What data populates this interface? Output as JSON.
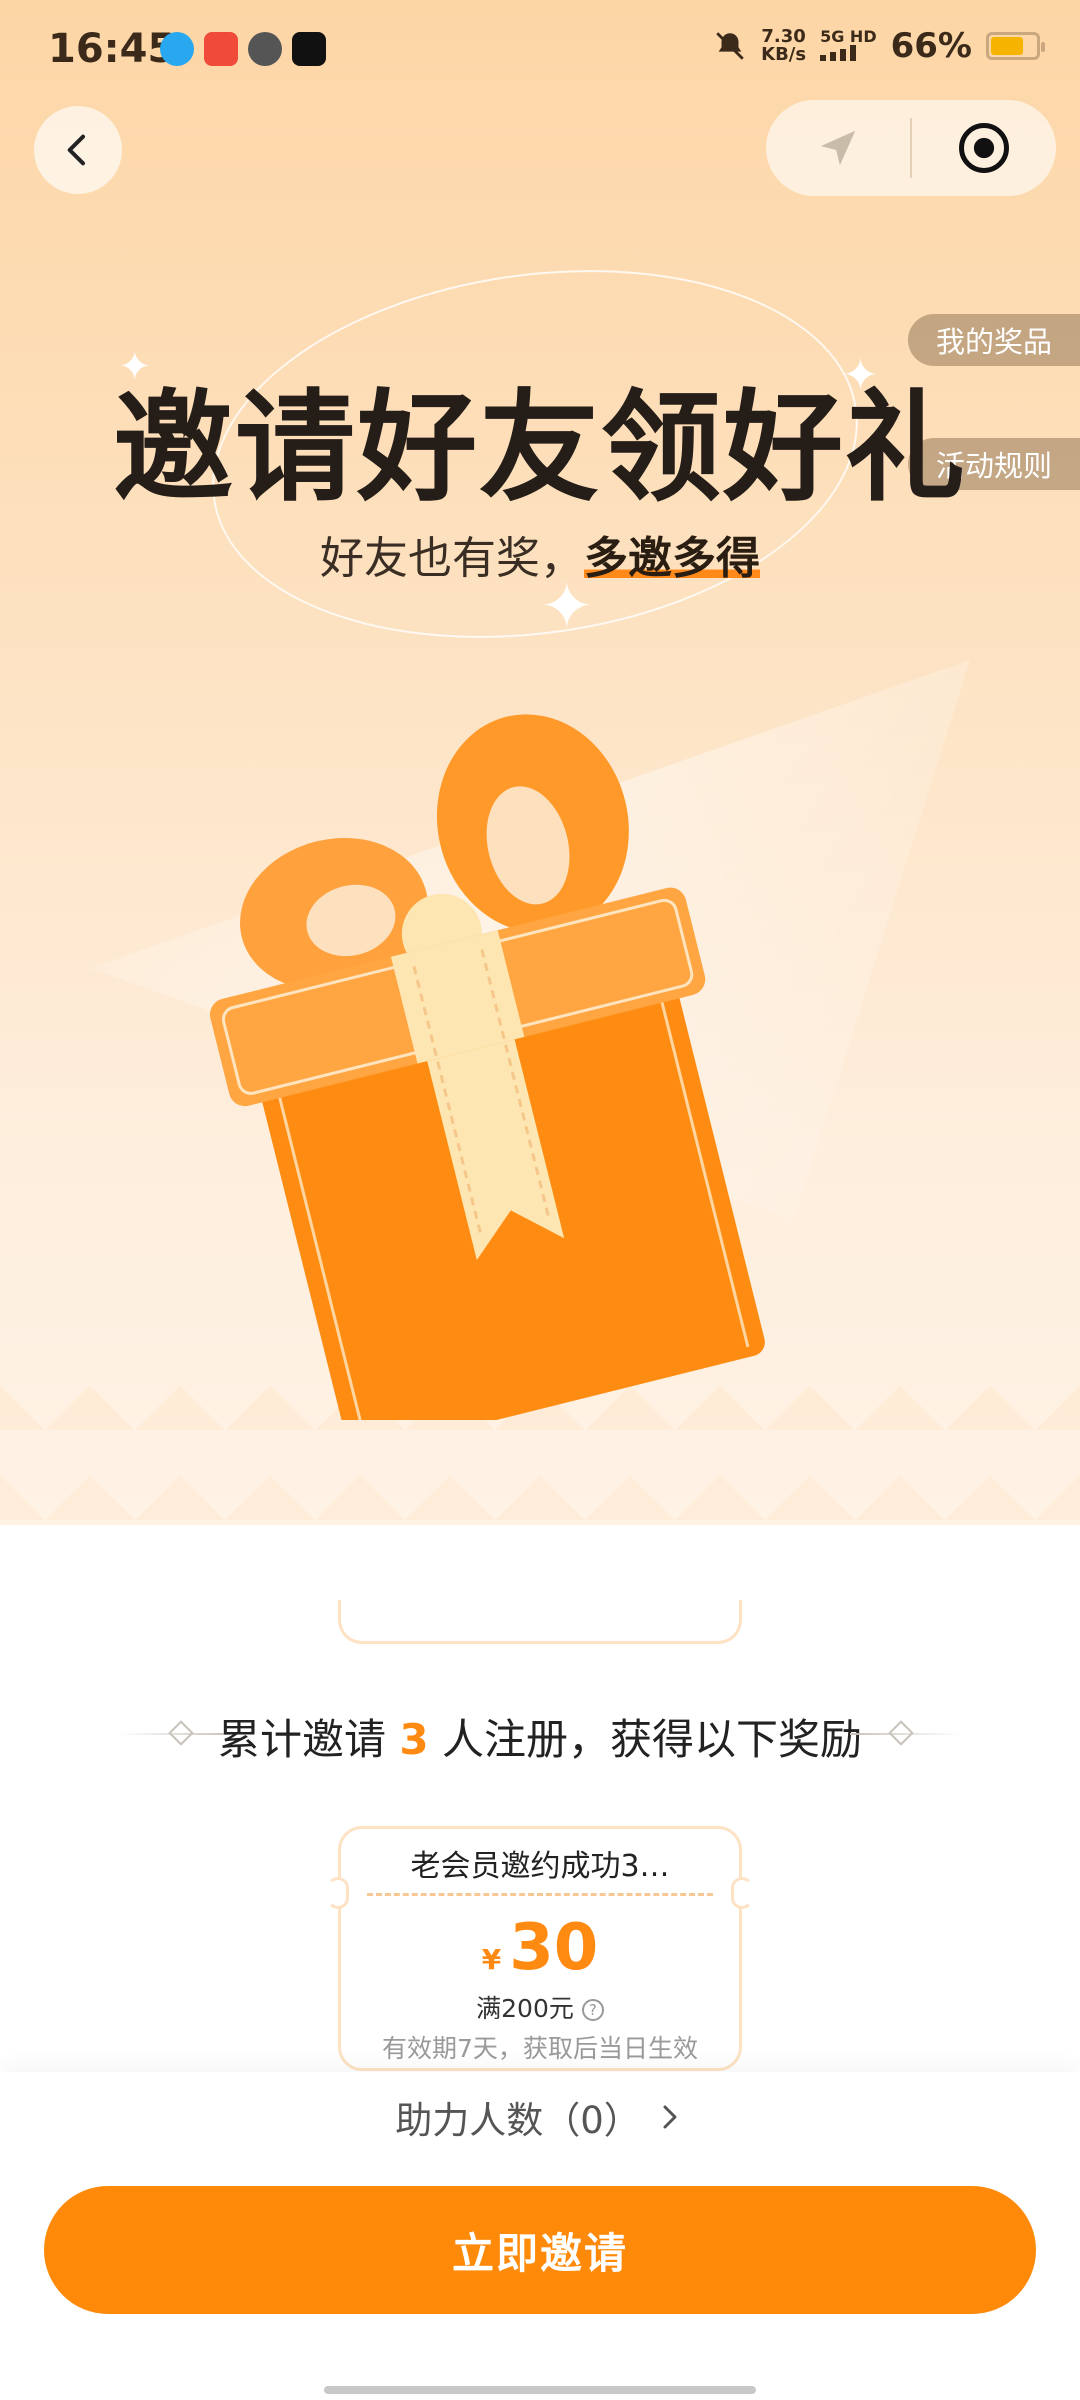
{
  "status_bar": {
    "time": "16:45",
    "net_speed_value": "7.30",
    "net_speed_unit": "KB/s",
    "signal_label": "5G HD",
    "battery_percent": "66%"
  },
  "header": {
    "my_prizes": "我的奖品",
    "rules": "活动规则"
  },
  "hero": {
    "title": "邀请好友领好礼",
    "subtitle_plain": "好友也有奖，",
    "subtitle_highlight": "多邀多得"
  },
  "reward": {
    "prefix": "累计邀请",
    "count": "3",
    "suffix": "人注册，获得以下奖励"
  },
  "coupon": {
    "name": "老会员邀约成功3…",
    "currency": "¥",
    "amount": "30",
    "condition": "满200元",
    "validity": "有效期7天，获取后当日生效"
  },
  "helpers": {
    "label": "助力人数（0）"
  },
  "cta": {
    "label": "立即邀请"
  },
  "colors": {
    "accent": "#ff8a0a",
    "hero_bg": "#fde0bd"
  }
}
